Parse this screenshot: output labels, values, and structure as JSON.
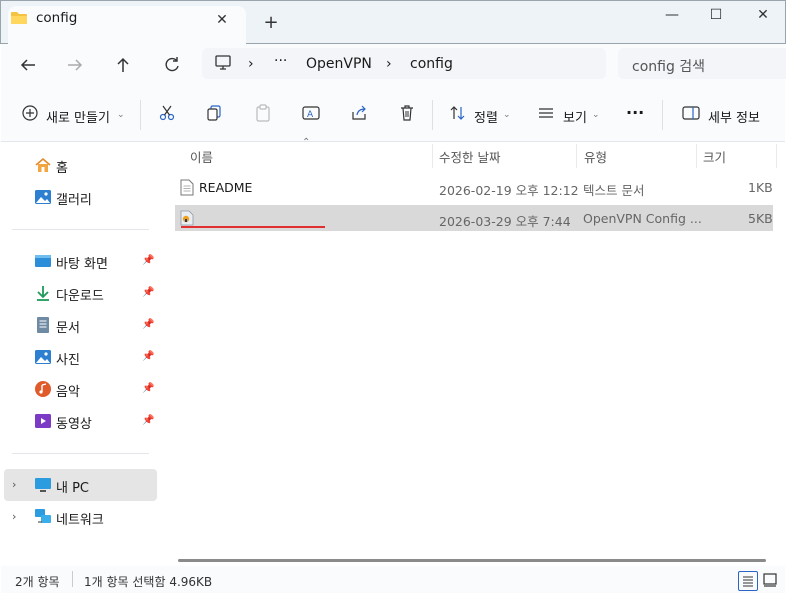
{
  "tab": {
    "title": "config",
    "close": "✕",
    "new_tab": "+"
  },
  "window": {
    "minimize": "—",
    "maximize": "☐",
    "close": "✕"
  },
  "breadcrumb": {
    "more": "···",
    "items": [
      "OpenVPN",
      "config"
    ],
    "separator": "›"
  },
  "search": {
    "placeholder": "config 검색"
  },
  "toolbar": {
    "new_label": "새로 만들기",
    "sort_label": "정렬",
    "view_label": "보기",
    "more_label": "···",
    "details_label": "세부 정보"
  },
  "nav": {
    "top": [
      {
        "label": "홈",
        "icon": "home-icon"
      },
      {
        "label": "갤러리",
        "icon": "gallery-icon"
      }
    ],
    "pinned": [
      {
        "label": "바탕 화면",
        "icon": "desktop-icon"
      },
      {
        "label": "다운로드",
        "icon": "download-icon"
      },
      {
        "label": "문서",
        "icon": "documents-icon"
      },
      {
        "label": "사진",
        "icon": "pictures-icon"
      },
      {
        "label": "음악",
        "icon": "music-icon"
      },
      {
        "label": "동영상",
        "icon": "videos-icon"
      }
    ],
    "pc": {
      "label": "내 PC"
    },
    "network": {
      "label": "네트워크"
    }
  },
  "columns": {
    "name": "이름",
    "modified": "수정한 날짜",
    "type": "유형",
    "size": "크기"
  },
  "files": [
    {
      "name": "README",
      "modified": "2026-02-19 오후 12:12",
      "type": "텍스트 문서",
      "size": "1KB",
      "icon": "text-file-icon",
      "selected": false
    },
    {
      "name": "",
      "modified": "2026-03-29 오후 7:44",
      "type": "OpenVPN Config ...",
      "size": "5KB",
      "icon": "openvpn-config-icon",
      "selected": true
    }
  ],
  "status": {
    "count": "2개 항목",
    "selection": "1개 항목 선택함 4.96KB"
  },
  "colors": {
    "accent": "#2b63c6",
    "folder": "#f5c342",
    "underline": "#e23030",
    "selected_row": "#d9d9d9"
  }
}
